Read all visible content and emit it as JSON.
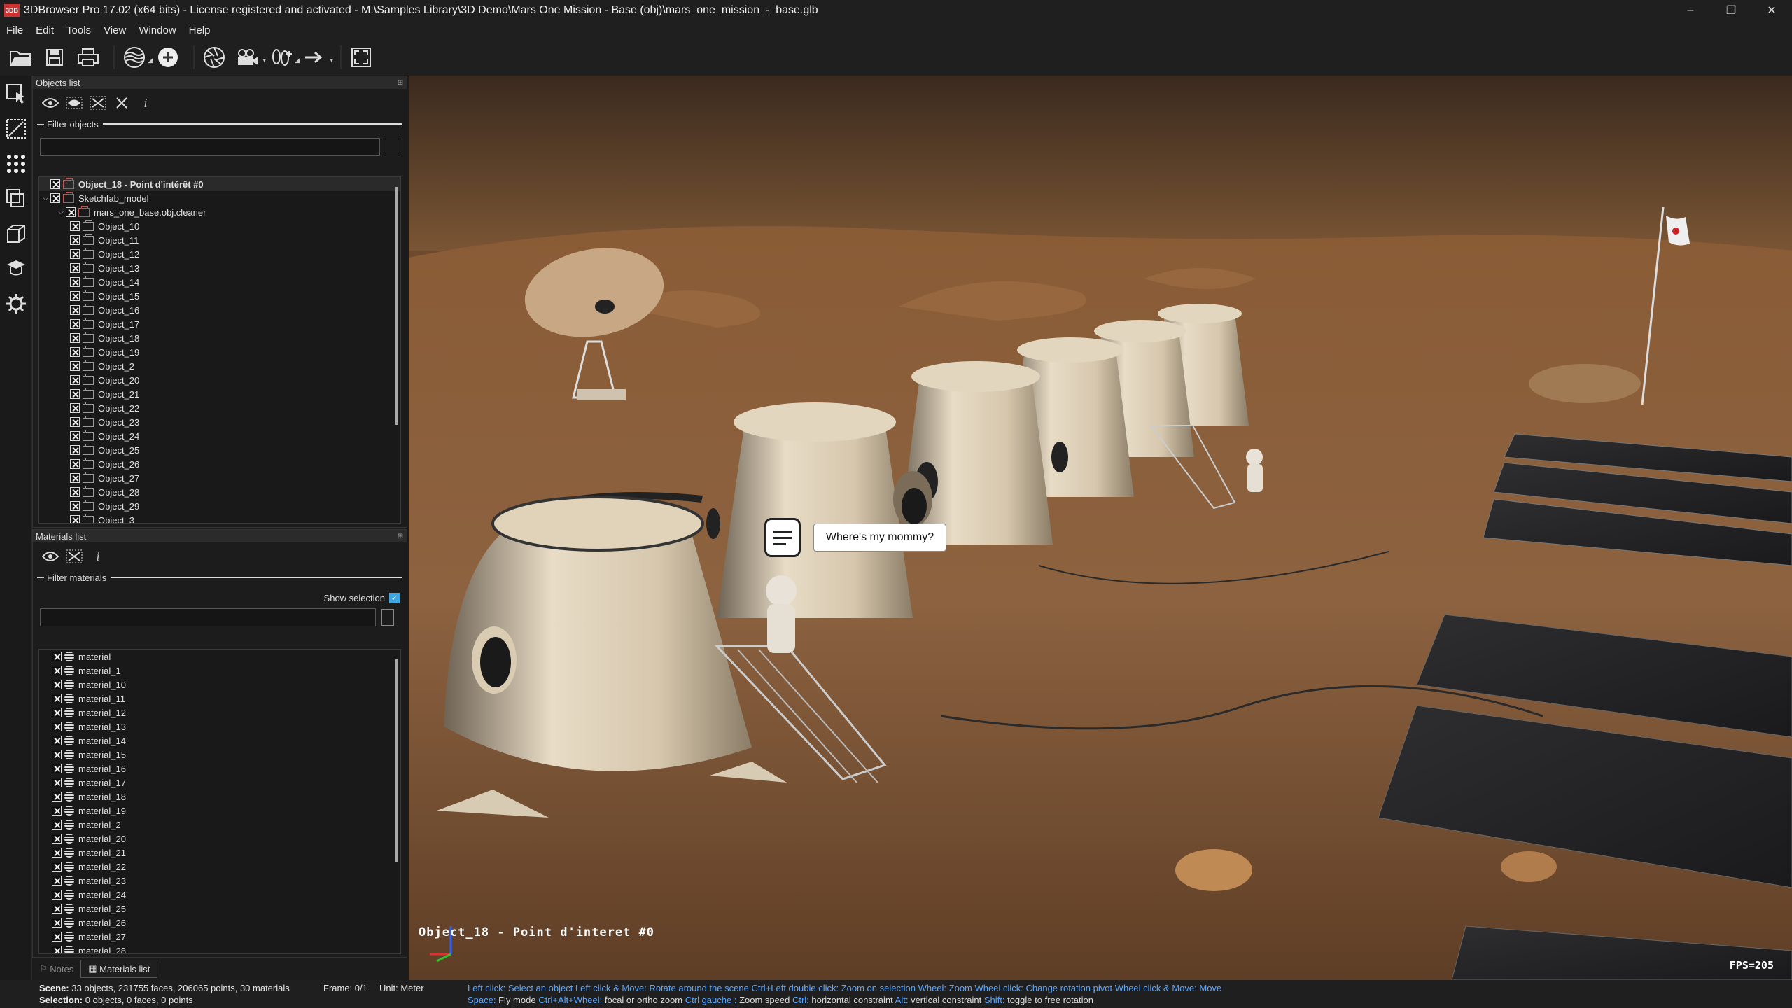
{
  "window": {
    "title": "3DBrowser Pro 17.02 (x64 bits) - License registered  and activated - M:\\Samples Library\\3D Demo\\Mars One Mission - Base (obj)\\mars_one_mission_-_base.glb",
    "app_icon": "3DB",
    "minimize": "–",
    "maximize": "❐",
    "close": "✕"
  },
  "menu": [
    "File",
    "Edit",
    "Tools",
    "View",
    "Window",
    "Help"
  ],
  "toolbar": [
    {
      "icon": "open-folder-icon"
    },
    {
      "icon": "save-icon"
    },
    {
      "icon": "print-icon"
    },
    {
      "icon": "render-mode-icon"
    },
    {
      "icon": "add-light-icon"
    },
    {
      "icon": "aperture-icon"
    },
    {
      "icon": "camera-icon"
    },
    {
      "icon": "walk-icon"
    },
    {
      "icon": "arrow-right-icon"
    },
    {
      "icon": "fullscreen-icon"
    }
  ],
  "objects_panel": {
    "title": "Objects list",
    "pin": "⊞",
    "filter_label": "Filter objects",
    "filter_value": "",
    "filter_btn": "",
    "selected": "Object_18 - Point d'intérêt #0",
    "root": "Sketchfab_model",
    "child": "mars_one_base.obj.cleaner",
    "items": [
      "Object_10",
      "Object_11",
      "Object_12",
      "Object_13",
      "Object_14",
      "Object_15",
      "Object_16",
      "Object_17",
      "Object_18",
      "Object_19",
      "Object_2",
      "Object_20",
      "Object_21",
      "Object_22",
      "Object_23",
      "Object_24",
      "Object_25",
      "Object_26",
      "Object_27",
      "Object_28",
      "Object_29",
      "Object_3"
    ]
  },
  "materials_panel": {
    "title": "Materials list",
    "pin": "⊞",
    "filter_label": "Filter materials",
    "show_selection": "Show selection",
    "show_selection_checked": true,
    "filter_value": "",
    "items": [
      "material",
      "material_1",
      "material_10",
      "material_11",
      "material_12",
      "material_13",
      "material_14",
      "material_15",
      "material_16",
      "material_17",
      "material_18",
      "material_19",
      "material_2",
      "material_20",
      "material_21",
      "material_22",
      "material_23",
      "material_24",
      "material_25",
      "material_26",
      "material_27",
      "material_28"
    ]
  },
  "bottom_tabs": {
    "notes": "Notes",
    "materials": "Materials list"
  },
  "viewport": {
    "speech": "Where's my mommy?",
    "object_label": "Object_18 - Point d'interet #0",
    "fps": "FPS=205"
  },
  "status": {
    "scene_label": "Scene:",
    "scene_value": "33 objects, 231755 faces, 206065 points, 30 materials",
    "frame": "Frame: 0/1",
    "unit": "Unit: Meter",
    "selection_label": "Selection:",
    "selection_value": "0 objects, 0 faces, 0 points",
    "hint1": [
      [
        "Left click:",
        "Select an object "
      ],
      [
        "Left click & Move:",
        "Rotate around the scene "
      ],
      [
        "Ctrl+Left double click:",
        "Zoom on selection "
      ],
      [
        "Wheel:",
        "Zoom "
      ],
      [
        "Wheel click:",
        "Change rotation pivot "
      ],
      [
        "Wheel click & Move:",
        "Move"
      ]
    ],
    "hint2": [
      [
        "Space:",
        "Fly mode "
      ],
      [
        "Ctrl+Alt+Wheel:",
        "focal or ortho zoom "
      ],
      [
        "Ctrl gauche :",
        "Zoom speed "
      ],
      [
        "Ctrl:",
        "horizontal constraint "
      ],
      [
        "Alt:",
        "vertical constraint "
      ],
      [
        "Shift:",
        "toggle to free rotation"
      ]
    ]
  }
}
